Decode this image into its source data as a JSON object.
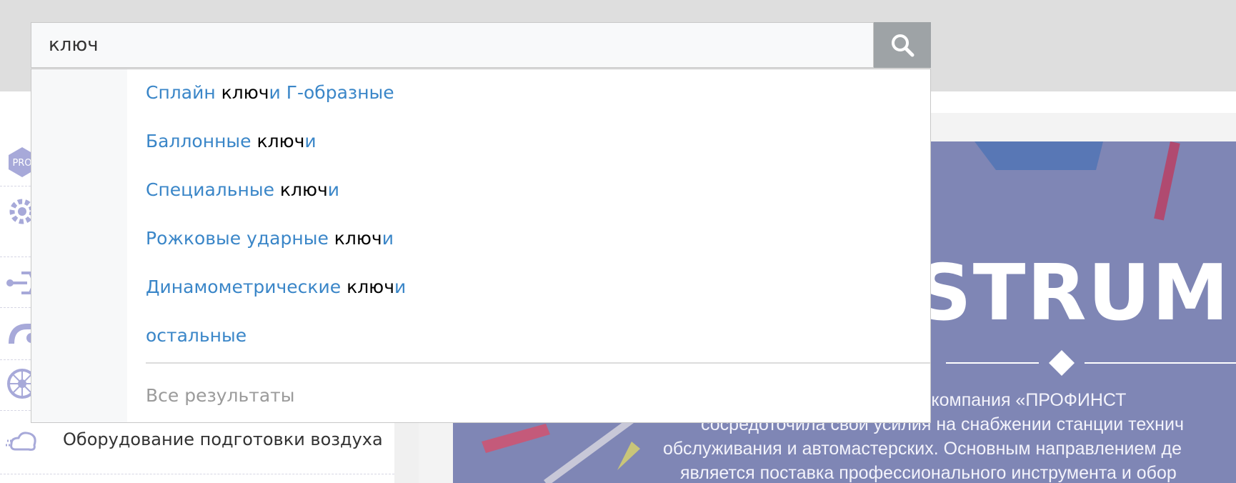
{
  "search": {
    "query": "ключ",
    "button_icon": "search-icon"
  },
  "suggestions": [
    {
      "pre": "Сплайн ",
      "match": "ключ",
      "post": "и Г-образные"
    },
    {
      "pre": "Баллонные ",
      "match": "ключ",
      "post": "и"
    },
    {
      "pre": "Специальные ",
      "match": "ключ",
      "post": "и"
    },
    {
      "pre": "Рожковые ударные ",
      "match": "ключ",
      "post": "и"
    },
    {
      "pre": "Динамометрические ",
      "match": "ключ",
      "post": "и"
    },
    {
      "pre": "остальные",
      "match": "",
      "post": ""
    }
  ],
  "all_results_label": "Все результаты",
  "sidebar": {
    "badge_text": "PRO",
    "visible_item": "Оборудование подготовки воздуха",
    "icons": [
      "pro-badge-icon",
      "gear-icon",
      "pipe-icon",
      "hose-icon",
      "sun-wheel-icon",
      "air-cloud-icon"
    ]
  },
  "banner": {
    "word": "STRUMENT",
    "lines": [
      "тельности компания «ПРОФИНСТ",
      "сосредоточила свои усилия на снабжении станции технич",
      "обслуживания и автомастерских. Основным направлением де",
      "является поставка профессионального инструмента и обор"
    ]
  },
  "colors": {
    "link": "#3a86c8",
    "highlight": "#000000",
    "muted": "#9b9b9b",
    "search_button": "#9ea3a6",
    "banner": "#7f86b5"
  }
}
